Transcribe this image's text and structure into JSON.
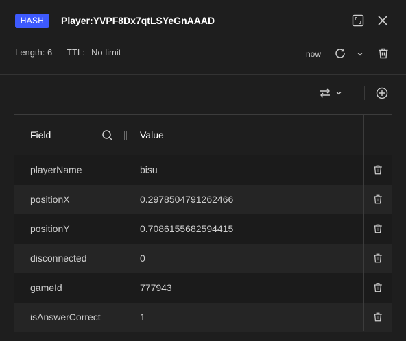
{
  "header": {
    "type_badge": "HASH",
    "key_name": "Player:YVPF8Dx7qtLSYeGnAAAD",
    "length_text": "Length: 6",
    "ttl_label": "TTL:",
    "ttl_value": "No limit",
    "refreshed": "now"
  },
  "icons": {
    "fullscreen": "fullscreen-icon",
    "close": "close-icon",
    "refresh": "refresh-icon",
    "dropdown": "chevron-down-icon",
    "delete": "trash-icon",
    "format": "swap-arrows-icon",
    "add": "plus-circle-icon",
    "search": "search-icon"
  },
  "colors": {
    "badge": "#3d5afe",
    "background": "#1e1e1e",
    "row_alt": "#252525",
    "border": "#3c3c3c"
  },
  "table": {
    "columns": {
      "field": "Field",
      "value": "Value"
    },
    "rows": [
      {
        "field": "playerName",
        "value": "bisu"
      },
      {
        "field": "positionX",
        "value": "0.2978504791262466"
      },
      {
        "field": "positionY",
        "value": "0.7086155682594415"
      },
      {
        "field": "disconnected",
        "value": "0"
      },
      {
        "field": "gameId",
        "value": "777943"
      },
      {
        "field": "isAnswerCorrect",
        "value": "1"
      }
    ]
  }
}
